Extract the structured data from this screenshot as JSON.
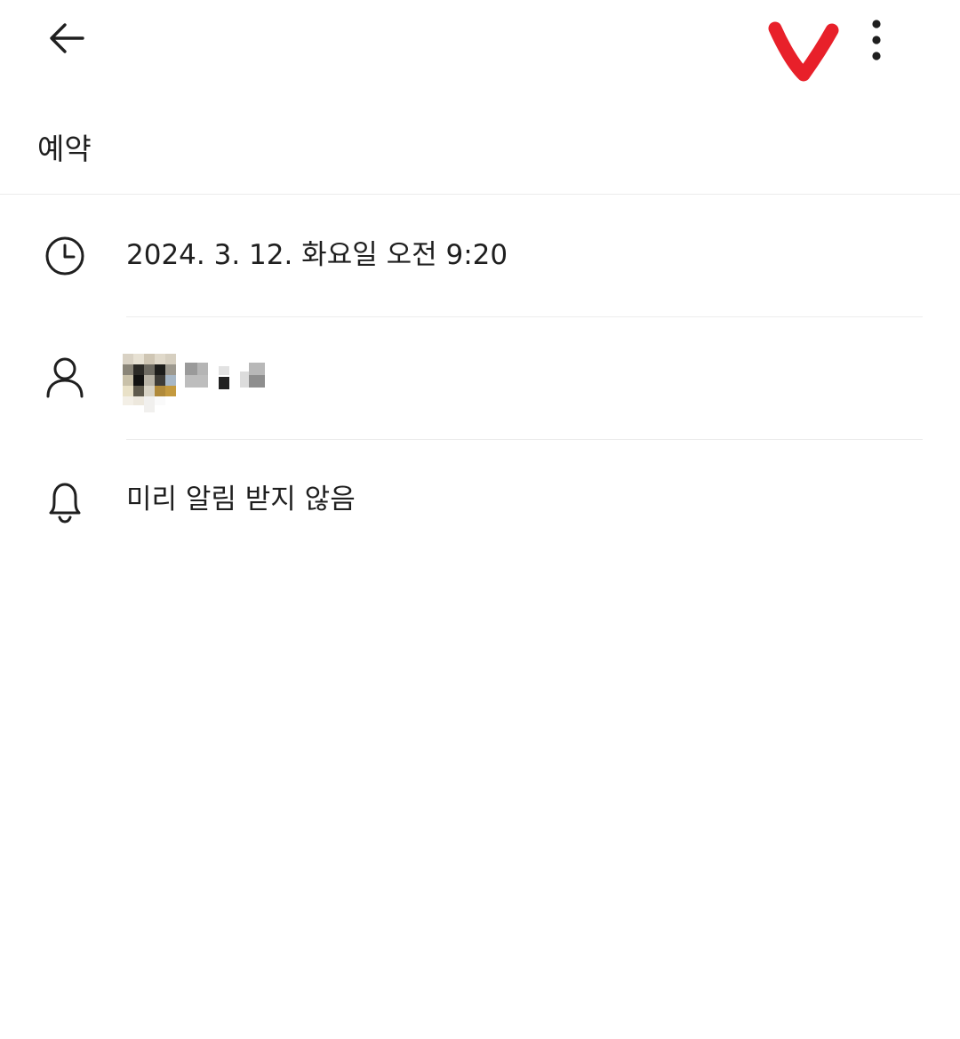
{
  "header": {
    "back_icon": "arrow-left-icon",
    "more_icon": "more-vertical-icon",
    "annotation_color": "#e8202a"
  },
  "title": "예약",
  "rows": {
    "time": {
      "icon": "clock-icon",
      "text": "2024. 3. 12. 화요일 오전 9:20"
    },
    "person": {
      "icon": "person-icon"
    },
    "alert": {
      "icon": "bell-icon",
      "text": "미리 알림 받지 않음"
    }
  }
}
